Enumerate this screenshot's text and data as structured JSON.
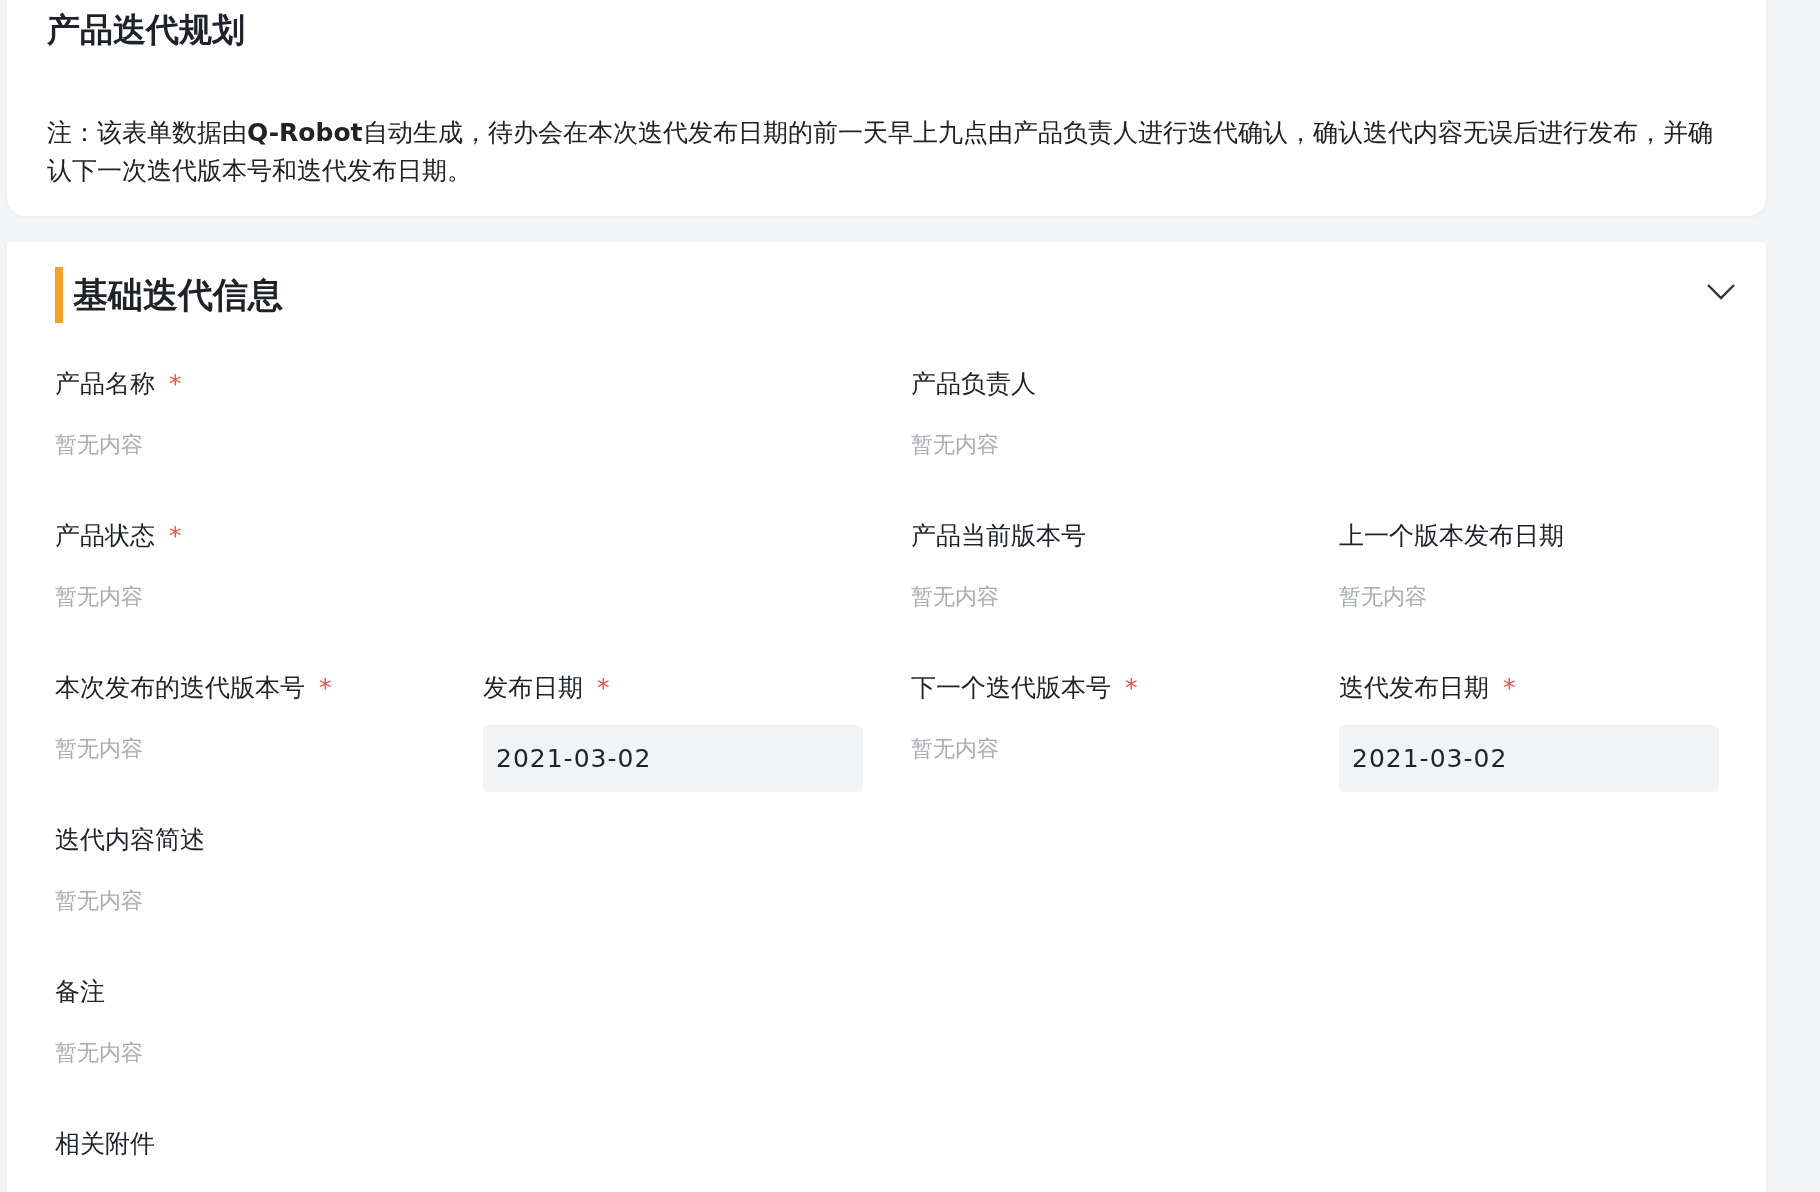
{
  "header": {
    "title": "产品迭代规划",
    "note": "注：该表单数据由**Q-Robot**自动生成，待办会在本次迭代发布日期的前一天早上九点由产品负责人进行迭代确认，确认迭代内容无误后进行发布，并确认下一次迭代版本号和迭代发布日期。"
  },
  "section": {
    "title": "基础迭代信息",
    "expanded": true,
    "rows": [
      [
        {
          "label": "产品名称",
          "mark": "*",
          "kind": "text",
          "value": "暂无内容"
        },
        "",
        {
          "label": "产品负责人",
          "kind": "text",
          "value": "暂无内容"
        }
      ],
      [
        {
          "label": "产品状态",
          "mark": "*",
          "kind": "text",
          "value": "暂无内容"
        },
        "",
        {
          "label": "产品当前版本号",
          "kind": "text",
          "value": "暂无内容"
        },
        {
          "label": "上一个版本发布日期",
          "kind": "text",
          "value": "暂无内容"
        }
      ],
      [
        {
          "label": "本次发布的迭代版本号",
          "mark": "*",
          "kind": "text",
          "value": "暂无内容"
        },
        {
          "label": "发布日期",
          "mark": "*",
          "kind": "date",
          "value": "2021-03-02"
        },
        {
          "label": "下一个迭代版本号",
          "mark": "*",
          "kind": "text",
          "value": "暂无内容"
        },
        {
          "label": "迭代发布日期",
          "mark": "*",
          "kind": "date",
          "value": "2021-03-02"
        }
      ],
      [
        {
          "label": "迭代内容简述",
          "kind": "text",
          "value": "暂无内容"
        }
      ],
      [
        {
          "label": "备注",
          "kind": "text",
          "value": "暂无内容"
        }
      ],
      [
        {
          "label": "相关附件",
          "kind": "text"
        }
      ]
    ]
  }
}
